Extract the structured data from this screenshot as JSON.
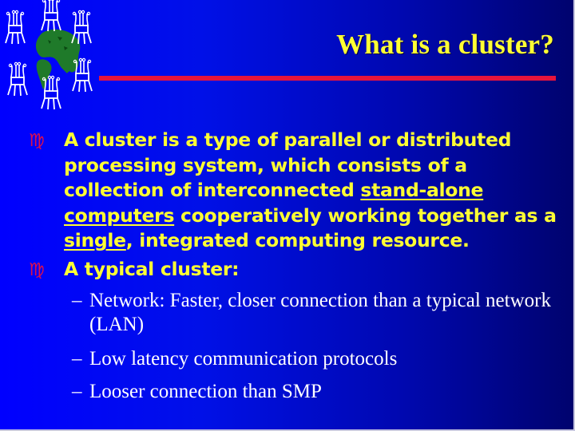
{
  "slide": {
    "title": "What is a cluster?",
    "colors": {
      "background_left": "#0000ff",
      "background_right": "#00036e",
      "title": "#ffff33",
      "title_rule": "#e8143c",
      "bullet_text": "#ffff33",
      "bullet_mark": "#e0104a",
      "sub_text": "#ffffff",
      "globe_land": "#1f7a2a",
      "chip_icon": "#ffffff"
    },
    "logo": {
      "icon": "globe-with-network-chips-icon",
      "alt": "Globe surrounded by computer chip icons"
    },
    "bullet_mark_glyph": "♍",
    "bullets": [
      {
        "segments": [
          {
            "text": "A cluster is a type of parallel or distributed processing system, which consists of a collection of interconnected ",
            "underline": false
          },
          {
            "text": "stand-alone computers",
            "underline": true
          },
          {
            "text": " cooperatively working together as a ",
            "underline": false
          },
          {
            "text": "single",
            "underline": true
          },
          {
            "text": ", integrated computing resource.",
            "underline": false
          }
        ]
      },
      {
        "segments": [
          {
            "text": "A typical cluster:",
            "underline": false
          }
        ],
        "sub_items": [
          {
            "dash": "–",
            "text": "Network: Faster, closer connection than a typical network (LAN)"
          },
          {
            "dash": "–",
            "text": "Low latency communication protocols"
          },
          {
            "dash": "–",
            "text": "Looser connection than SMP"
          }
        ]
      }
    ]
  }
}
